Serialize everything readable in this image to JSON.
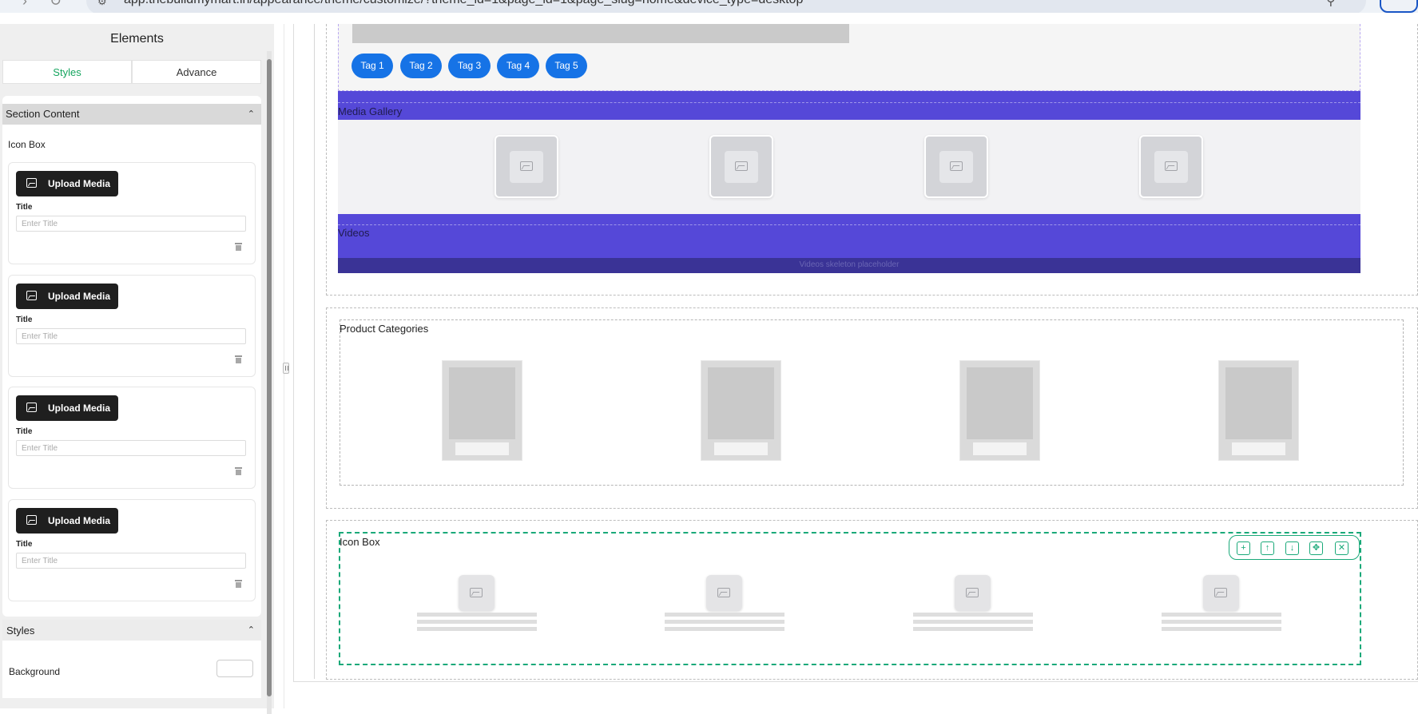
{
  "browser": {
    "url": "app.thebuildmymart.in/appearance/theme/customize/?theme_id=1&page_id=1&page_slug=home&device_type=desktop"
  },
  "panel": {
    "title": "Elements",
    "tabs": [
      {
        "label": "Styles",
        "active": true
      },
      {
        "label": "Advance",
        "active": false
      }
    ],
    "section_content_label": "Section Content",
    "icon_box_label": "Icon Box",
    "items": [
      {
        "upload_label": "Upload Media",
        "title_label": "Title",
        "title_value": "",
        "title_placeholder": "Enter Title"
      },
      {
        "upload_label": "Upload Media",
        "title_label": "Title",
        "title_value": "",
        "title_placeholder": "Enter Title"
      },
      {
        "upload_label": "Upload Media",
        "title_label": "Title",
        "title_value": "",
        "title_placeholder": "Enter Title"
      },
      {
        "upload_label": "Upload Media",
        "title_label": "Title",
        "title_value": "",
        "title_placeholder": "Enter Title"
      }
    ],
    "styles_label": "Styles",
    "background_label": "Background",
    "background_color": "#ffffff"
  },
  "canvas": {
    "tags": [
      "Tag 1",
      "Tag 2",
      "Tag 3",
      "Tag 4",
      "Tag 5"
    ],
    "media_gallery_label": "Media Gallery",
    "videos_label": "Videos",
    "videos_placeholder": "Videos skeleton placeholder",
    "product_categories_label": "Product Categories",
    "icon_box_label": "Icon Box"
  },
  "colors": {
    "accent_green": "#16a55f",
    "selection_green": "#1aa979",
    "tag_blue": "#1673e6",
    "band_purple": "#5548d8",
    "upload_button": "#1f1f1f"
  },
  "icons": [
    "back-arrow-icon",
    "reload-icon",
    "site-info-icon",
    "search-icon",
    "profile-icon",
    "chevron-up-icon",
    "image-icon",
    "trash-icon",
    "drag-handle-icon",
    "duplicate-icon",
    "move-up-icon",
    "move-down-icon",
    "move-icon",
    "close-icon"
  ]
}
